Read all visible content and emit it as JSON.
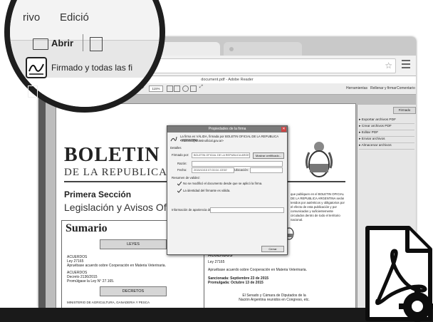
{
  "browser": {
    "omnibox_star": "☆",
    "menu_icon": "hamburger-menu-icon"
  },
  "acrobat": {
    "window_title": "document.pdf - Adobe Reader",
    "toolbar": {
      "zoom": "115%",
      "herramientas": "Herramientas",
      "rellenar_firmar": "Rellenar y firmar",
      "comentario": "Comentario"
    },
    "right_panel": {
      "items": [
        "Exportar archivos PDF",
        "Crear archivos PDF",
        "Editar PDF",
        "Enviar archivos",
        "Almacenar archivos"
      ],
      "button": "Firmado"
    }
  },
  "document": {
    "title": "BOLETIN O",
    "subtitle": "DE LA REPUBLICA A",
    "section": "Primera Sección",
    "section_sub": "Legislación y Avisos Oficial",
    "summary_title": "Sumario",
    "leyes_label": "LEYES",
    "decretos_label": "DECRETOS",
    "left_column": [
      "ACUERDOS",
      "Ley 27165",
      "Apruébase acuerdo sobre Cooperación en Materia Veterinaria.",
      "ACUERDOS",
      "Decreto 2136/2015",
      "Promúlgase la Ley N° 27.165.",
      "MINISTERIO DE AGRICULTURA, GANADERIA Y PESCA"
    ],
    "right_column": {
      "heading": "ACUERDOS",
      "law": "Ley 27165",
      "desc": "Apruébase acuerdo sobre Cooperación en Materia Veterinaria.",
      "sanction": "Sancionada: Septiembre 23 de 2015",
      "promulgation": "Promulgada: Octubre 13 de 2015",
      "congress": "El Senado y Cámara de Diputados de la Nación Argentina reunidos en Congreso, etc."
    },
    "notice": "que publiquen en el BOLETIN OFICIAL DE LA REPUBLICA ARGENTINA serán tenidos por auténticos y obligatorios por el efecto de esta publicación y por comunicados y suficientemente circulados dentro de todo el territorio nacional."
  },
  "dialog": {
    "title": "Propiedades de la firma",
    "intro": "La firma es VÁLIDA, firmada por BOLETIN OFICIAL DE LA REPUBLICA ARGENTINA",
    "email": "<editorial@boletinoficial.gov.ar>",
    "detalles": "Detalles",
    "firmado_por_label": "Firmado por:",
    "firmado_por_value": "BOLETIN OFICIAL DE LA REPUBLICA ARGENTINA <editorial@...>",
    "show_cert": "Mostrar certificado...",
    "razon_label": "Razón:",
    "fecha_label": "Fecha:",
    "fecha_value": "2015/10/15 07:00:04 -03'00'",
    "ubicacion_label": "Ubicación:",
    "resumen": "Resumen de validez:",
    "check1": "No se modificó el documento desde que se aplicó la firma.",
    "check2": "La identidad del firmante es válida.",
    "info": "Información de apariencia de firma",
    "close": "Cerrar"
  },
  "magnifier": {
    "menu_archivo": "rivo",
    "menu_edicion": "Edició",
    "abrir": "Abrir",
    "firmado": "Firmado y todas las fi"
  }
}
